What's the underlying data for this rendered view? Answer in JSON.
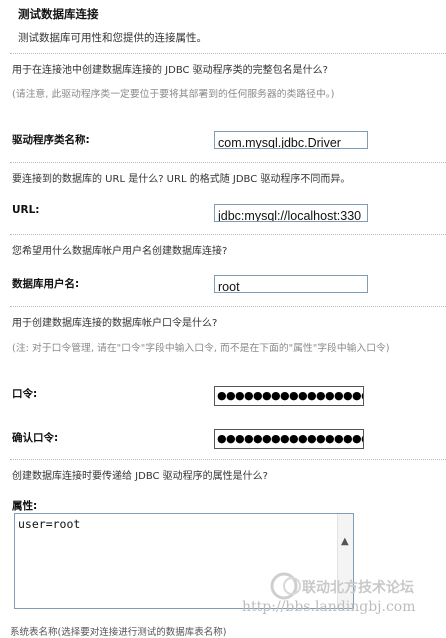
{
  "header": {
    "title": "测试数据库连接",
    "subtitle": "测试数据库可用性和您提供的连接属性。"
  },
  "driver": {
    "question": "用于在连接池中创建数据库连接的 JDBC 驱动程序类的完整包名是什么?",
    "note": "(请注意, 此驱动程序类一定要位于要将其部署到的任何服务器的类路径中。)",
    "label": "驱动程序类名称:",
    "value": "com.mysql.jdbc.Driver"
  },
  "url": {
    "question": "要连接到的数据库的 URL 是什么? URL 的格式随 JDBC 驱动程序不同而异。",
    "label": "URL:",
    "value": "jdbc:mysql://localhost:330"
  },
  "username": {
    "question": "您希望用什么数据库帐户用户名创建数据库连接?",
    "label": "数据库用户名:",
    "value": "root"
  },
  "password": {
    "question": "用于创建数据库连接的数据库帐户口令是什么?",
    "note": "(注: 对于口令管理, 请在\"口令\"字段中输入口令, 而不是在下面的\"属性\"字段中输入口令)",
    "label": "口令:",
    "value": "●●●●●●●●●●●●●●●●●●●",
    "confirm_label": "确认口令:",
    "confirm_value": "●●●●●●●●●●●●●●●●●●●"
  },
  "properties": {
    "question": "创建数据库连接时要传递给 JDBC 驱动程序的属性是什么?",
    "label": "属性:",
    "value": "user=root"
  },
  "watermark": {
    "line1": "联动北方技术论坛",
    "line2": "http://bbs.landingbj.com"
  },
  "footer": {
    "cut_text": "系统表名称(选择要对连接进行测试的数据库表名称)"
  },
  "colors": {
    "field_border": "#7f9db9",
    "note_gray": "#8a8a8a",
    "watermark_gray": "#c9c9c9"
  }
}
